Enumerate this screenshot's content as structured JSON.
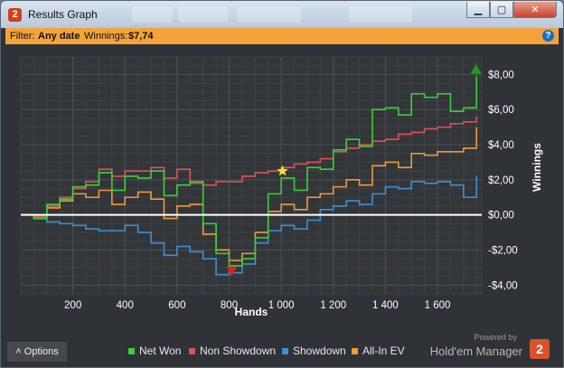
{
  "window": {
    "title": "Results Graph",
    "app_icon": "2",
    "controls": {
      "minimize": "▁",
      "maximize": "▢",
      "close": "✕"
    }
  },
  "filter": {
    "prefix": "Filter:",
    "date_value": "Any date",
    "winnings_label": "Winnings:",
    "winnings_value": "$7,74",
    "help_icon": "?"
  },
  "chart_data": {
    "type": "line",
    "xlabel": "Hands",
    "ylabel": "Winnings",
    "xlim": [
      0,
      1770
    ],
    "ylim": [
      -4.5,
      9
    ],
    "x_ticks": [
      200,
      400,
      600,
      800,
      1000,
      1200,
      1400,
      1600
    ],
    "x_tick_labels": [
      "200",
      "400",
      "600",
      "800",
      "1 000",
      "1 200",
      "1 400",
      "1 600"
    ],
    "y_ticks": [
      -4,
      -2,
      0,
      2,
      4,
      6,
      8
    ],
    "y_tick_labels": [
      "-$4,00",
      "-$2,00",
      "$0,00",
      "$2,00",
      "$4,00",
      "$6,00",
      "$8,00"
    ],
    "grid": true,
    "legend": "bottom",
    "x": [
      0,
      50,
      100,
      150,
      200,
      250,
      300,
      350,
      400,
      450,
      500,
      550,
      600,
      650,
      700,
      750,
      800,
      850,
      900,
      950,
      1000,
      1050,
      1100,
      1150,
      1200,
      1250,
      1300,
      1350,
      1400,
      1450,
      1500,
      1550,
      1600,
      1650,
      1700,
      1750
    ],
    "series": [
      {
        "name": "Net Won",
        "color": "#3ad13a",
        "values": [
          0,
          -0.2,
          0.6,
          0.9,
          1.6,
          1.7,
          2.4,
          1.4,
          2.2,
          2.1,
          2.5,
          1.1,
          1.7,
          1.9,
          -0.5,
          -2.2,
          -2.9,
          -2.5,
          -1.3,
          1.2,
          2.1,
          1.4,
          2.7,
          2.6,
          3.7,
          4.3,
          3.9,
          6.0,
          6.1,
          5.7,
          6.9,
          6.7,
          6.9,
          5.9,
          6.1,
          7.9
        ]
      },
      {
        "name": "Non Showdown",
        "color": "#e05252",
        "values": [
          0,
          -0.1,
          0.5,
          1.0,
          1.5,
          1.9,
          2.6,
          2.2,
          2.5,
          2.5,
          2.7,
          2.1,
          2.6,
          1.8,
          1.7,
          1.9,
          1.9,
          2.2,
          2.4,
          2.5,
          2.7,
          2.9,
          3.0,
          3.2,
          3.6,
          3.8,
          4.0,
          4.2,
          4.3,
          4.6,
          4.7,
          4.9,
          5.0,
          5.2,
          5.3,
          5.6
        ]
      },
      {
        "name": "Showdown",
        "color": "#3e8fd6",
        "values": [
          0,
          -0.2,
          -0.4,
          -0.5,
          -0.6,
          -0.8,
          -0.9,
          -0.9,
          -0.6,
          -1.0,
          -1.6,
          -2.3,
          -1.8,
          -2.1,
          -2.5,
          -3.4,
          -3.3,
          -2.8,
          -1.6,
          -0.9,
          -0.6,
          -0.8,
          -0.3,
          0.3,
          0.5,
          0.8,
          0.6,
          1.2,
          1.6,
          1.5,
          1.9,
          1.8,
          1.9,
          1.7,
          1.0,
          2.2
        ]
      },
      {
        "name": "All-In EV",
        "color": "#f09a3a",
        "values": [
          0,
          -0.2,
          0.4,
          0.8,
          1.2,
          1.0,
          1.4,
          0.6,
          1.0,
          1.3,
          0.9,
          -0.2,
          0.5,
          0.6,
          -1.1,
          -2.0,
          -2.6,
          -2.2,
          -1.0,
          0.2,
          0.6,
          0.3,
          1.0,
          1.2,
          1.6,
          2.0,
          1.7,
          2.8,
          3.0,
          2.7,
          3.5,
          3.4,
          3.6,
          3.6,
          3.8,
          5.0
        ]
      }
    ],
    "markers": [
      {
        "kind": "star",
        "color": "#f0e030",
        "x": 1005,
        "y": 2.5
      },
      {
        "kind": "triangle-down",
        "color": "#e02020",
        "x": 810,
        "y": -3.2
      },
      {
        "kind": "triangle-up",
        "color": "#1f9a1f",
        "x": 1748,
        "y": 8.3
      }
    ]
  },
  "footer": {
    "options_label": "Options",
    "options_icon": "˄",
    "powered_by": "Powered by",
    "brand": "Hold'em Manager",
    "brand_logo": "2"
  }
}
